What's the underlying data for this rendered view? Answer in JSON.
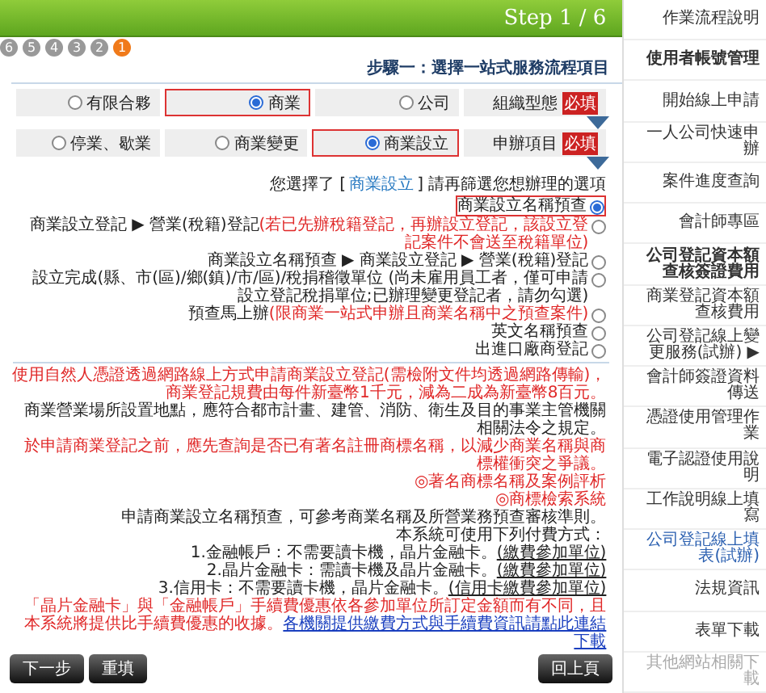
{
  "header": {
    "title": "Step 1 / 6"
  },
  "steps": [
    {
      "label": "6",
      "selected": false
    },
    {
      "label": "5",
      "selected": false
    },
    {
      "label": "4",
      "selected": false
    },
    {
      "label": "3",
      "selected": false
    },
    {
      "label": "2",
      "selected": false
    },
    {
      "label": "1",
      "selected": true
    }
  ],
  "heading": "步驟一：選擇一站式服務流程項目",
  "option_rows": [
    {
      "label": "組織型態",
      "badge": "必填",
      "options": [
        {
          "label": "有限合夥",
          "selected": false
        },
        {
          "label": "商業",
          "selected": true
        },
        {
          "label": "公司",
          "selected": false
        }
      ]
    },
    {
      "label": "申辦項目",
      "badge": "必填",
      "options": [
        {
          "label": "停業、歇業",
          "selected": false
        },
        {
          "label": "商業變更",
          "selected": false
        },
        {
          "label": "商業設立",
          "selected": true
        }
      ]
    }
  ],
  "choice_prompt": {
    "before": "您選擇了 [",
    "choice": "商業設立",
    "after": "] 請再篩選您想辦理的選項"
  },
  "services": [
    {
      "text": "商業設立名稱預查",
      "selected": true
    },
    {
      "text": "商業設立登記 ▶ 營業(稅籍)登記",
      "note": "(若已先辦稅籍登記，再辦設立登記，該設立登記案件不會送至稅籍單位)",
      "selected": false
    },
    {
      "text": "商業設立名稱預查 ▶ 商業設立登記 ▶ 營業(稅籍)登記",
      "selected": false
    },
    {
      "text": "設立完成(縣、市(區)/鄉(鎮)/市/區)/稅捐稽徵單位 (尚未雇用員工者，僅可申請設立登記稅捐單位;已辦理變更登記者，請勿勾選)",
      "selected": false
    },
    {
      "text": "預查馬上辦",
      "note": "(限商業一站式申辦且商業名稱中之預查案件)",
      "selected": false
    },
    {
      "text": "英文名稱預查",
      "selected": false
    },
    {
      "text": "出進口廠商登記",
      "selected": false
    }
  ],
  "notes": [
    {
      "kind": "red",
      "text": "使用自然人憑證透過網路線上方式申請商業設立登記(需檢附文件均透過網路傳輸)，商業登記規費由每件新臺幣1千元，減為二成為新臺幣8百元。"
    },
    {
      "kind": "plain",
      "text": "商業營業場所設置地點，應符合都市計畫、建管、消防、衛生及目的事業主管機關相關法令之規定。"
    },
    {
      "kind": "red",
      "text": "於申請商業登記之前，應先查詢是否已有著名註冊商標名稱，以減少商業名稱與商標權衝突之爭議。",
      "links": [
        "◎著名商標名稱及案例評析",
        "◎商標檢索系統"
      ]
    },
    {
      "kind": "plain",
      "text": "申請商業設立名稱預查，可參考商業名稱及所營業務預查審核準則。"
    },
    {
      "kind": "plain",
      "text": "本系統可使用下列付費方式：",
      "payments": [
        {
          "text": "1.金融帳戶：不需要讀卡機，晶片金融卡。",
          "link": "(繳費參加單位)"
        },
        {
          "text": "2.晶片金融卡：需讀卡機及晶片金融卡。",
          "link": "(繳費參加單位)"
        },
        {
          "text": "3.信用卡：不需要讀卡機，晶片金融卡。",
          "link": "(信用卡繳費參加單位)"
        }
      ],
      "footer": "「晶片金融卡」與「金融帳戶」手續費優惠依各參加單位所訂定金額而有不同，且本系統將提供比手續費優惠的收據。",
      "footer_link": "各機關提供繳費方式與手續費資訊請點此連結下載"
    }
  ],
  "buttons": {
    "next": "下一步",
    "reset": "重填",
    "back": "回上頁"
  },
  "sidebar": [
    {
      "label": "作業流程說明",
      "kind": "normal"
    },
    {
      "label": "使用者帳號管理",
      "kind": "bold"
    },
    {
      "label": "開始線上申請",
      "kind": "normal"
    },
    {
      "label": "一人公司快速申辦",
      "kind": "normal"
    },
    {
      "label": "案件進度查詢",
      "kind": "normal"
    },
    {
      "label": "會計師專區",
      "kind": "normal"
    },
    {
      "label": "公司登記資本額查核簽證費用",
      "kind": "bold"
    },
    {
      "label": "商業登記資本額查核費用",
      "kind": "normal"
    },
    {
      "label": "公司登記線上變更服務(試辦) ▶",
      "kind": "normal"
    },
    {
      "label": "會計師簽證資料傳送",
      "kind": "normal"
    },
    {
      "label": "憑證使用管理作業",
      "kind": "normal"
    },
    {
      "label": "電子認證使用說明",
      "kind": "normal"
    },
    {
      "label": "工作說明線上填寫",
      "kind": "normal"
    },
    {
      "label": "公司登記線上填表(試辦)",
      "kind": "blue"
    },
    {
      "label": "法規資訊",
      "kind": "normal"
    },
    {
      "label": "表單下載",
      "kind": "normal"
    },
    {
      "label": "其他網站相關下載",
      "kind": "grey"
    }
  ]
}
